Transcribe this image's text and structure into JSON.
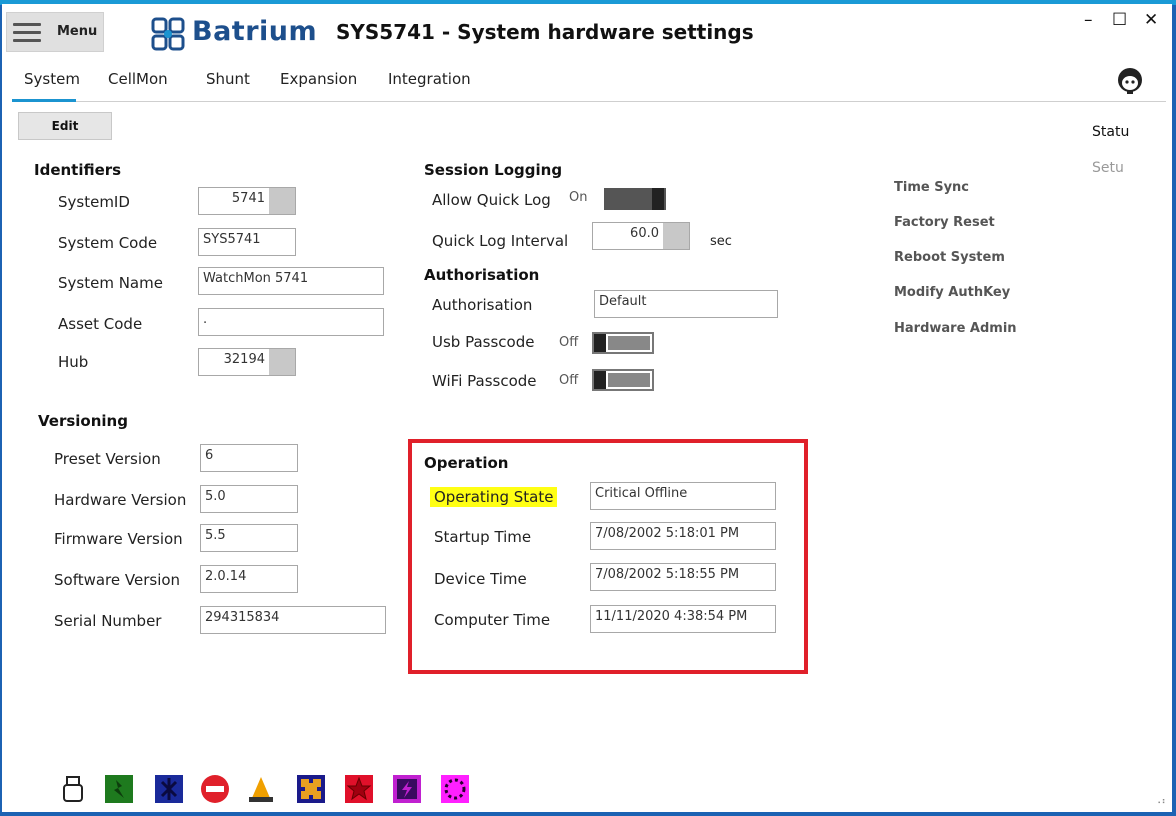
{
  "header": {
    "menu_label": "Menu",
    "brand": "Batrium",
    "title": "SYS5741 - System hardware settings",
    "minimize": "–",
    "maximize": "☐",
    "close": "✕"
  },
  "tabs": [
    "System",
    "CellMon",
    "Shunt",
    "Expansion",
    "Integration"
  ],
  "side_tabs": [
    "Statu",
    "Setu"
  ],
  "edit_label": "Edit",
  "identifiers": {
    "heading": "Identifiers",
    "system_id_label": "SystemID",
    "system_id": "5741",
    "system_code_label": "System Code",
    "system_code": "SYS5741",
    "system_name_label": "System Name",
    "system_name": "WatchMon 5741",
    "asset_code_label": "Asset Code",
    "asset_code": ".",
    "hub_label": "Hub",
    "hub": "32194"
  },
  "versioning": {
    "heading": "Versioning",
    "preset_label": "Preset Version",
    "preset": "6",
    "hardware_label": "Hardware Version",
    "hardware": "5.0",
    "firmware_label": "Firmware Version",
    "firmware": "5.5",
    "software_label": "Software Version",
    "software": "2.0.14",
    "serial_label": "Serial Number",
    "serial": "294315834"
  },
  "session_logging": {
    "heading": "Session Logging",
    "quick_log_label": "Allow Quick Log",
    "quick_log_state": "On",
    "interval_label": "Quick Log Interval",
    "interval": "60.0",
    "interval_unit": "sec"
  },
  "authorisation": {
    "heading": "Authorisation",
    "auth_label": "Authorisation",
    "auth_value": "Default",
    "usb_label": "Usb Passcode",
    "usb_state": "Off",
    "wifi_label": "WiFi Passcode",
    "wifi_state": "Off"
  },
  "operation": {
    "heading": "Operation",
    "state_label": "Operating State",
    "state": "Critical Offline",
    "startup_label": "Startup Time",
    "startup": "7/08/2002 5:18:01 PM",
    "device_label": "Device Time",
    "device": "7/08/2002 5:18:55 PM",
    "computer_label": "Computer Time",
    "computer": "11/11/2020 4:38:54 PM"
  },
  "actions": [
    "Time Sync",
    "Factory Reset",
    "Reboot System",
    "Modify AuthKey",
    "Hardware Admin"
  ],
  "colors": {
    "accent": "#1b94d0",
    "highlight_box": "#e0202a",
    "highlight_text": "#ffff14"
  },
  "bottom_icons": [
    "usb-icon",
    "green-status-icon",
    "bluetooth-off-icon",
    "no-entry-icon",
    "wizard-hat-icon",
    "puzzle-icon",
    "red-star-icon",
    "purple-flash-icon",
    "magenta-dots-icon"
  ],
  "resize_grip": "⠠⠆"
}
